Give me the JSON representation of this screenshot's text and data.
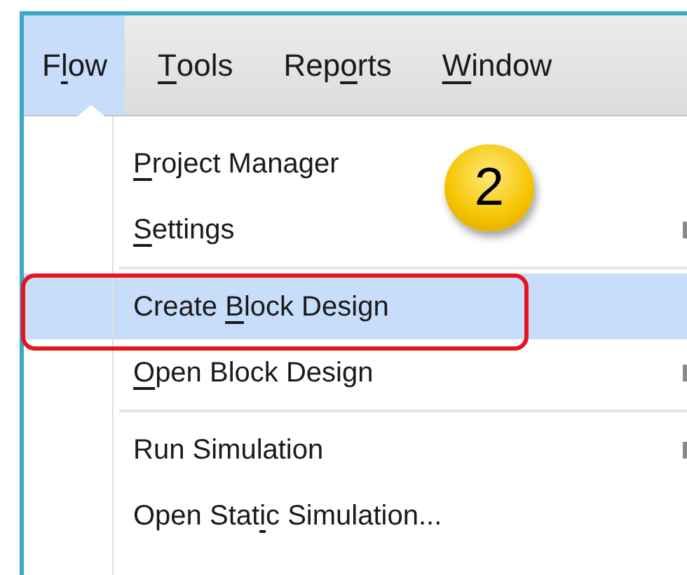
{
  "menu_bar": [
    {
      "before": "F",
      "key": "l",
      "after": "ow",
      "selected": true
    },
    {
      "key": "T",
      "after": "ools",
      "selected": false
    },
    {
      "before": "Rep",
      "key": "o",
      "after": "rts",
      "selected": false
    },
    {
      "key": "W",
      "after": "indow",
      "selected": false
    }
  ],
  "dropdown": [
    {
      "kind": "item",
      "key": "P",
      "after": "roject Manager",
      "selected": false,
      "submenu": false
    },
    {
      "kind": "item",
      "key": "S",
      "after": "ettings",
      "selected": false,
      "submenu": true
    },
    {
      "kind": "separator"
    },
    {
      "kind": "item",
      "before": "Create ",
      "key": "B",
      "after": "lock Design",
      "selected": true,
      "submenu": false
    },
    {
      "kind": "item",
      "key": "O",
      "after": "pen Block Design",
      "selected": false,
      "submenu": true
    },
    {
      "kind": "separator"
    },
    {
      "kind": "item",
      "before": "Run Simulation",
      "selected": false,
      "submenu": true
    },
    {
      "kind": "item",
      "before": "Open Stat",
      "key": "i",
      "after": "c Simulation...",
      "selected": false,
      "submenu": false
    }
  ],
  "annotation": {
    "step": "2"
  }
}
